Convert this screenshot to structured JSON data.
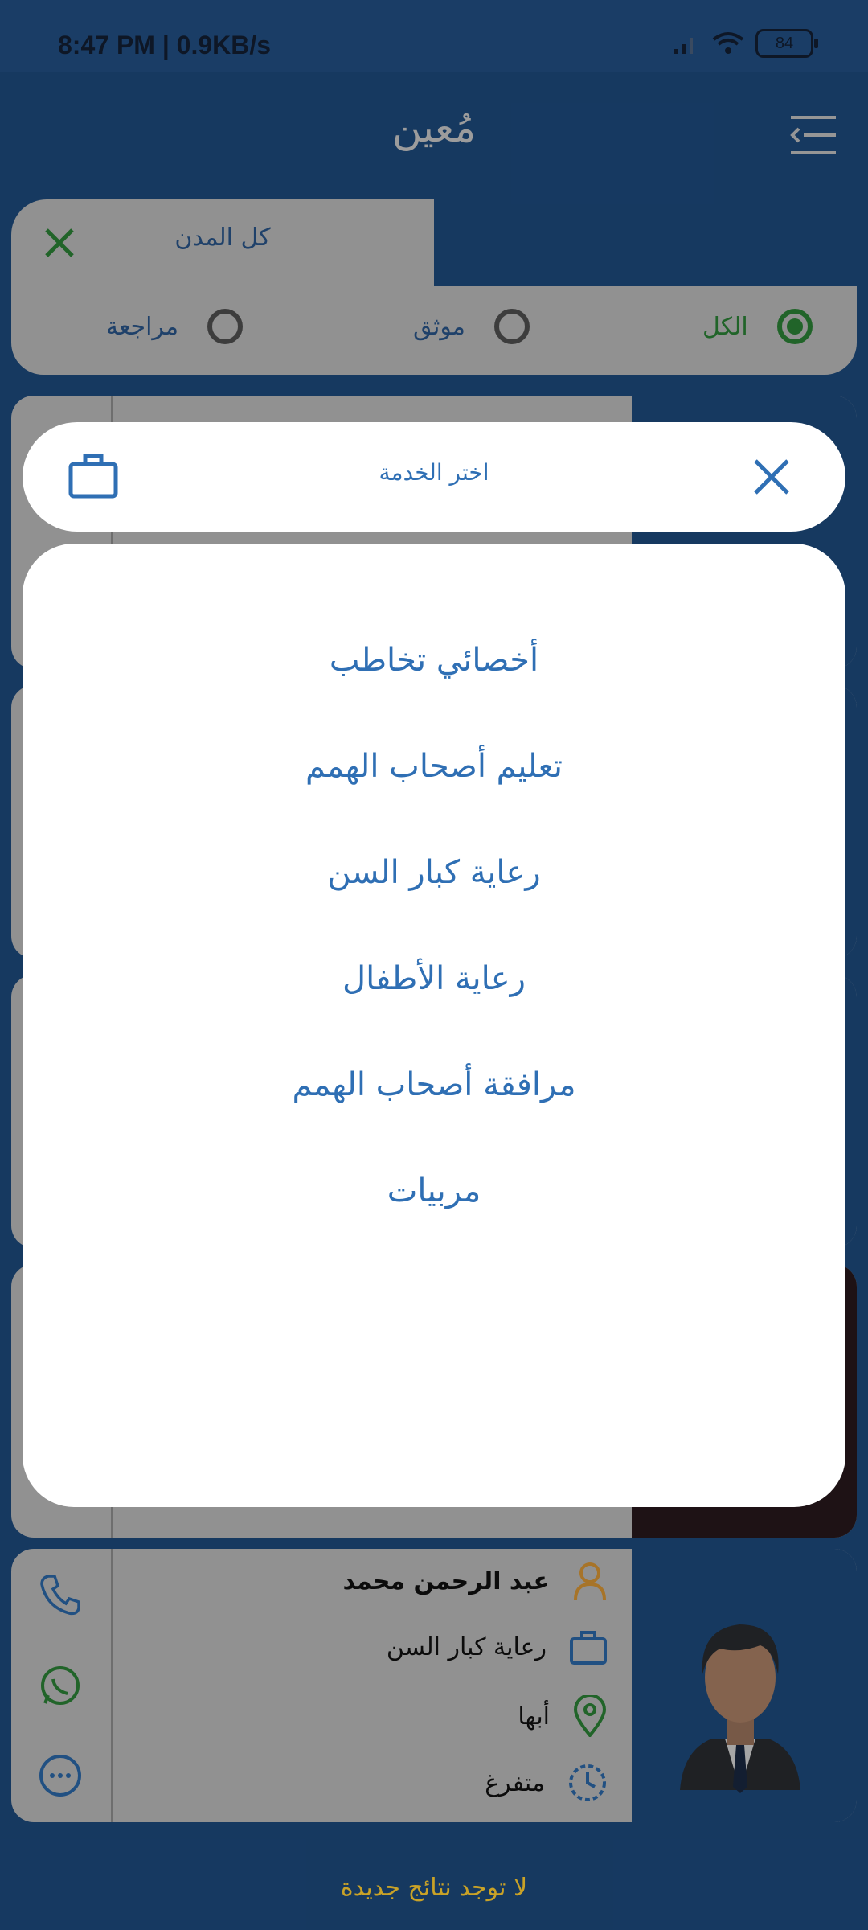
{
  "status_bar": {
    "time": "8:47 PM | 0.9KB/s",
    "battery": "84"
  },
  "header": {
    "title": "مُعين"
  },
  "filters": {
    "city": "كل المدن",
    "radios": [
      {
        "label": "الكل",
        "selected": true
      },
      {
        "label": "موثق",
        "selected": false
      },
      {
        "label": "مراجعة",
        "selected": false
      }
    ]
  },
  "modal": {
    "title": "اختر الخدمة",
    "services": [
      "أخصائي تخاطب",
      "تعليم أصحاب الهمم",
      "رعاية  كبار السن",
      "رعاية الأطفال",
      "مرافقة أصحاب الهمم",
      "مربيات"
    ]
  },
  "last_card": {
    "name": "عبد الرحمن محمد",
    "service": "رعاية  كبار السن",
    "city": "أبها",
    "status": "متفرغ"
  },
  "footer": {
    "no_results": "لا توجد نتائج جديدة"
  },
  "colors": {
    "primary": "#1f4f86",
    "accent_blue": "#2f6fb4",
    "green": "#2e8b3a",
    "orange": "#e8a13a",
    "gold": "#c9a227"
  }
}
